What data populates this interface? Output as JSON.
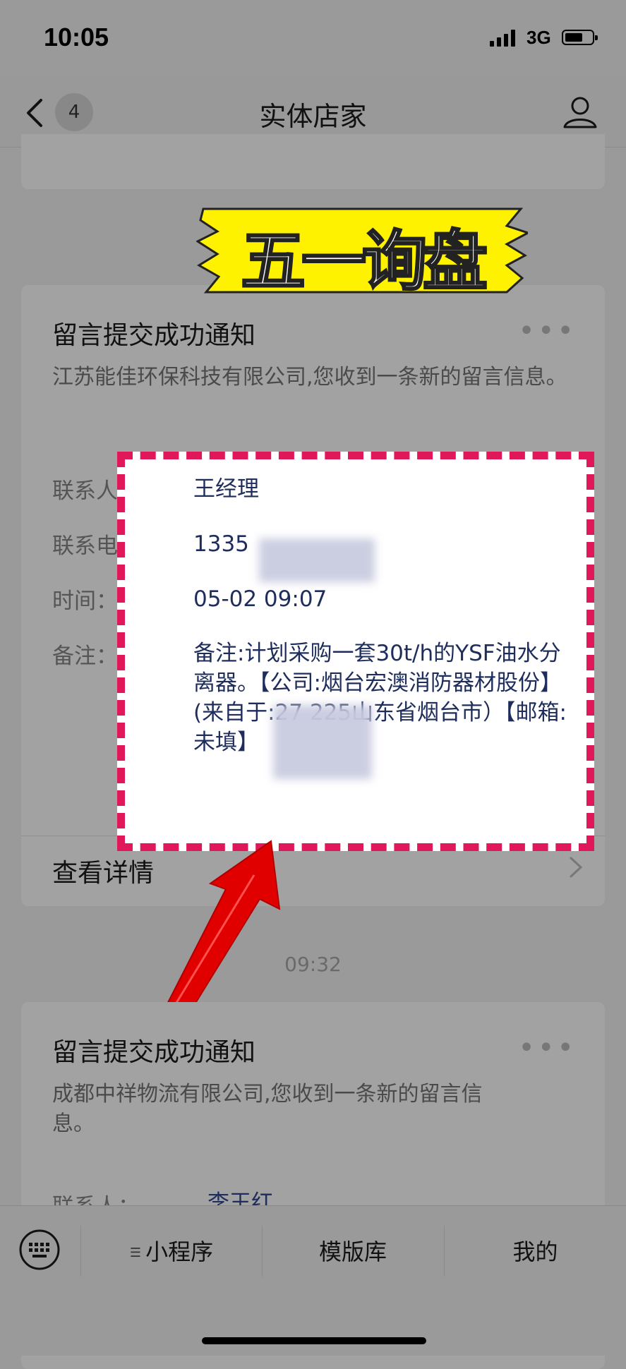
{
  "status": {
    "time": "10:05",
    "network": "3G"
  },
  "nav": {
    "badge": "4",
    "title": "实体店家"
  },
  "banner": {
    "text": "五一询盘"
  },
  "card1": {
    "title": "留言提交成功通知",
    "more": "•••",
    "desc": "江苏能佳环保科技有限公司,您收到一条新的留言信息。",
    "fields": [
      {
        "label": "联系人：",
        "value": "王经理"
      },
      {
        "label": "联系电话：",
        "value": "1335"
      },
      {
        "label": "时间：",
        "value": "05-02 09:07"
      },
      {
        "label": "备注：",
        "value": "备注:计划采购一套30t/h的YSF油水分离器。【公司:烟台宏澳消防器材股份】(来自于:27          225山东省烟台市）【邮箱:未填】"
      }
    ],
    "detail": "查看详情"
  },
  "timestamp": "09:32",
  "card2": {
    "title": "留言提交成功通知",
    "more": "•••",
    "desc": "成都中祥物流有限公司,您收到一条新的留言信息。",
    "field_label": "联系人：",
    "field_value": "李王红"
  },
  "bottom": {
    "tabs": [
      "小程序",
      "模版库",
      "我的"
    ]
  },
  "colors": {
    "highlight_border": "#e0185a",
    "banner_bg": "#fff200",
    "arrow": "#e00000",
    "value_text": "#1e2d5c"
  }
}
